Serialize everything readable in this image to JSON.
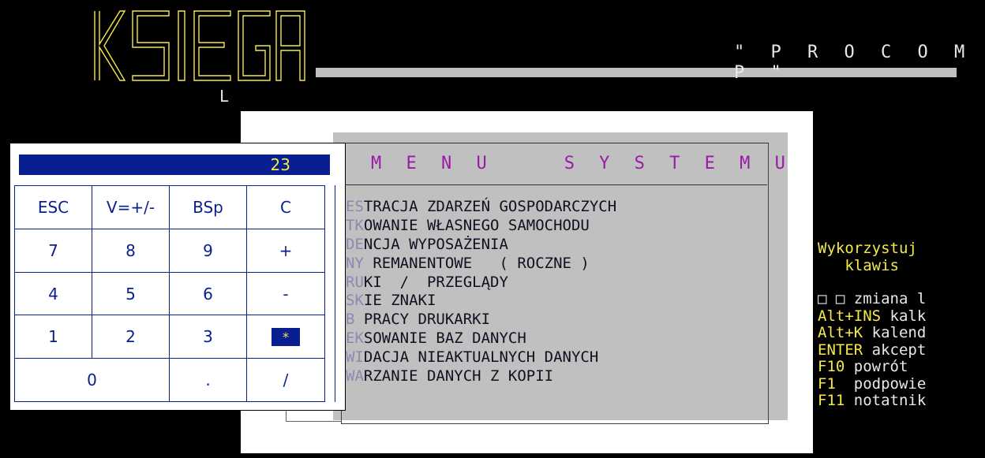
{
  "app": {
    "logo_text": "KSIEGA",
    "logo_sub": "L",
    "company": "\" P R O C O M P \""
  },
  "menu": {
    "title": "M E N U    S Y S T E M U",
    "items": [
      {
        "prefix": "ES",
        "text": "TRACJA ZDARZEŃ GOSPODARCZYCH"
      },
      {
        "prefix": "TK",
        "text": "OWANIE WŁASNEGO SAMOCHODU"
      },
      {
        "prefix": "DE",
        "text": "NCJA WYPOSAŻENIA"
      },
      {
        "prefix": "NY",
        "text": " REMANENTOWE   ( ROCZNE )"
      },
      {
        "prefix": "RU",
        "text": "KI  /  PRZEGLĄDY"
      },
      {
        "prefix": "SK",
        "text": "IE ZNAKI"
      },
      {
        "prefix": "B ",
        "text": "PRACY DRUKARKI"
      },
      {
        "prefix": "EK",
        "text": "SOWANIE BAZ DANYCH"
      },
      {
        "prefix": "WI",
        "text": "DACJA NIEAKTUALNYCH DANYCH"
      },
      {
        "prefix": "WA",
        "text": "RZANIE DANYCH Z KOPII"
      }
    ]
  },
  "calculator": {
    "display": "23",
    "rows": [
      [
        "ESC",
        "V=+/-",
        "BSp",
        "C"
      ],
      [
        "7",
        "8",
        "9",
        "+"
      ],
      [
        "4",
        "5",
        "6",
        "-"
      ],
      [
        "1",
        "2",
        "3",
        "*"
      ],
      [
        "0",
        ".",
        "/"
      ]
    ]
  },
  "help": {
    "title1": "Wykorzystuj",
    "title2": "   klawis",
    "lines": [
      {
        "key": "",
        "text": "□ □ zmiana l"
      },
      {
        "key": "Alt+INS",
        "text": " kalk"
      },
      {
        "key": "Alt+K",
        "text": " kalend"
      },
      {
        "key": "ENTER",
        "text": " akcept"
      },
      {
        "key": "F10",
        "text": " powrót"
      },
      {
        "key": "F1",
        "text": "  podpowie"
      },
      {
        "key": "F11",
        "text": " notatnik"
      }
    ]
  },
  "colors": {
    "calc_blue": "#0a1f8f",
    "display_text": "#f4e84a",
    "menu_title": "#9a1aa8",
    "menu_panel": "#c0c0c0",
    "help_key": "#f4e84a"
  }
}
